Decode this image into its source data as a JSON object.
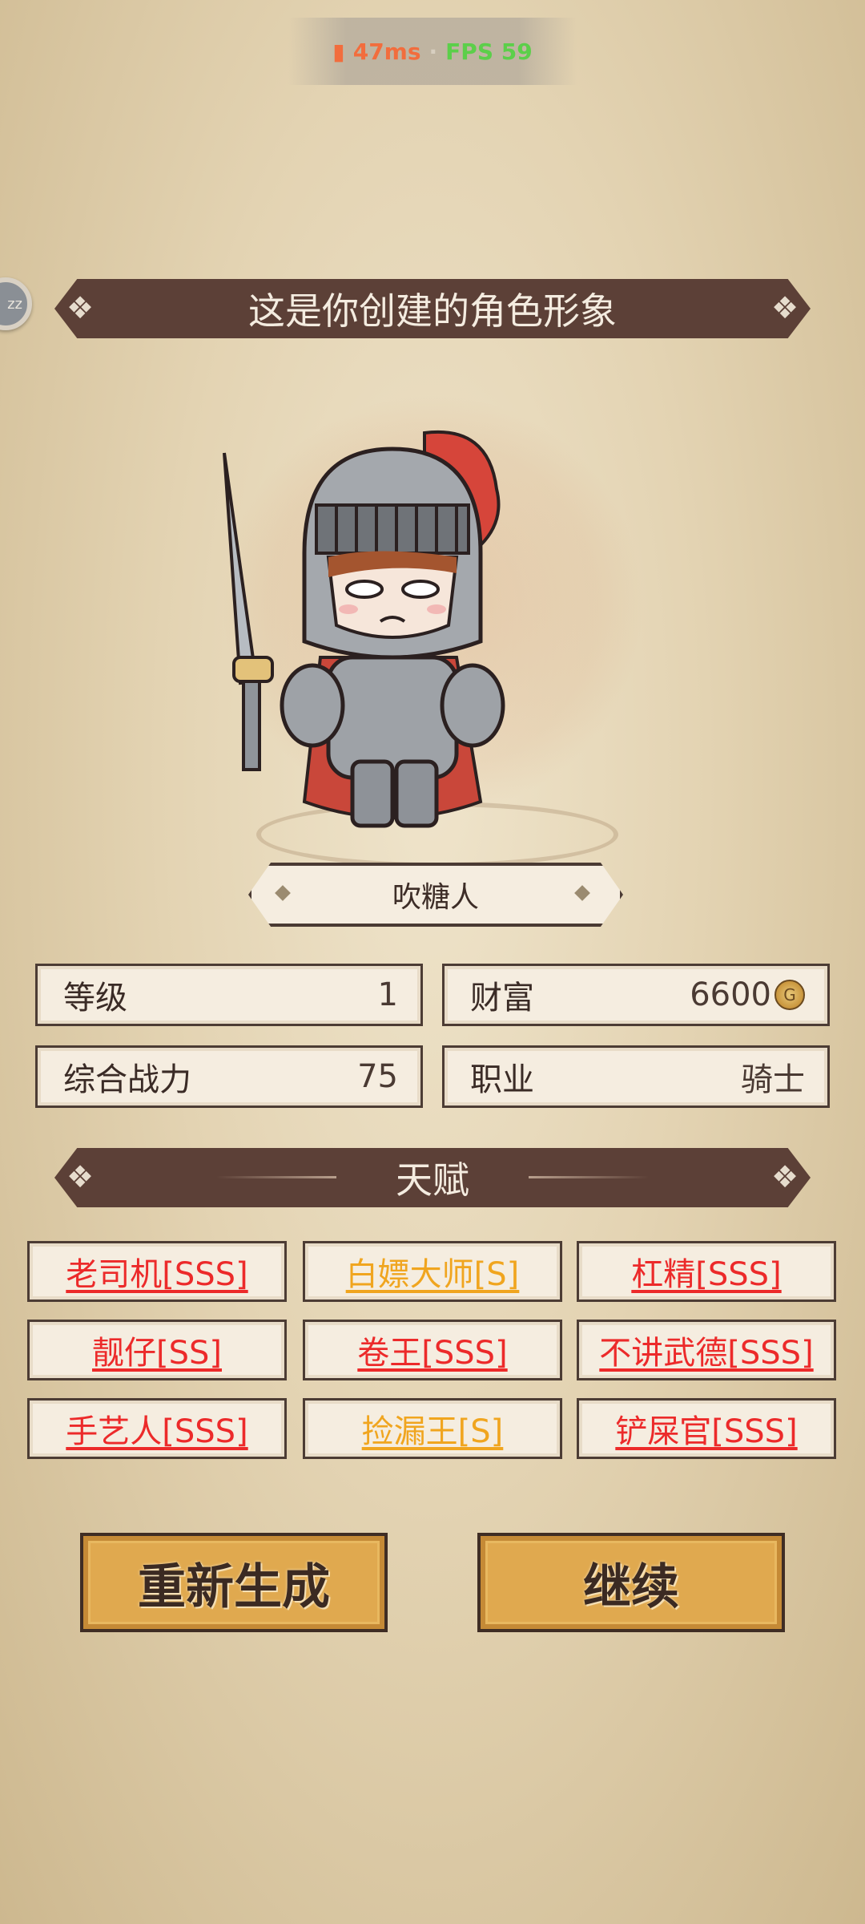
{
  "status": {
    "ping": "47ms",
    "separator": "·",
    "fps": "FPS 59"
  },
  "side_button": {
    "label": "zz"
  },
  "title": "这是你创建的角色形象",
  "character": {
    "name": "吹糖人"
  },
  "stats": [
    {
      "label": "等级",
      "value": "1"
    },
    {
      "label": "财富",
      "value": "6600"
    },
    {
      "label": "综合战力",
      "value": "75"
    },
    {
      "label": "职业",
      "value": "骑士"
    }
  ],
  "talent_header": "天赋",
  "talents": [
    {
      "label": "老司机[SSS]",
      "grade_color": "#ec2a2a"
    },
    {
      "label": "白嫖大师[S]",
      "grade_color": "#f0a51f"
    },
    {
      "label": "杠精[SSS]",
      "grade_color": "#ec2a2a"
    },
    {
      "label": "靓仔[SS]",
      "grade_color": "#ec2a2a"
    },
    {
      "label": "卷王[SSS]",
      "grade_color": "#ec2a2a"
    },
    {
      "label": "不讲武德[SSS]",
      "grade_color": "#ec2a2a"
    },
    {
      "label": "手艺人[SSS]",
      "grade_color": "#ec2a2a"
    },
    {
      "label": "捡漏王[S]",
      "grade_color": "#f0a51f"
    },
    {
      "label": "铲屎官[SSS]",
      "grade_color": "#ec2a2a"
    }
  ],
  "buttons": {
    "regenerate": "重新生成",
    "continue": "继续"
  },
  "icons": {
    "coin": "coin-icon",
    "character": "knight-character-illustration"
  }
}
